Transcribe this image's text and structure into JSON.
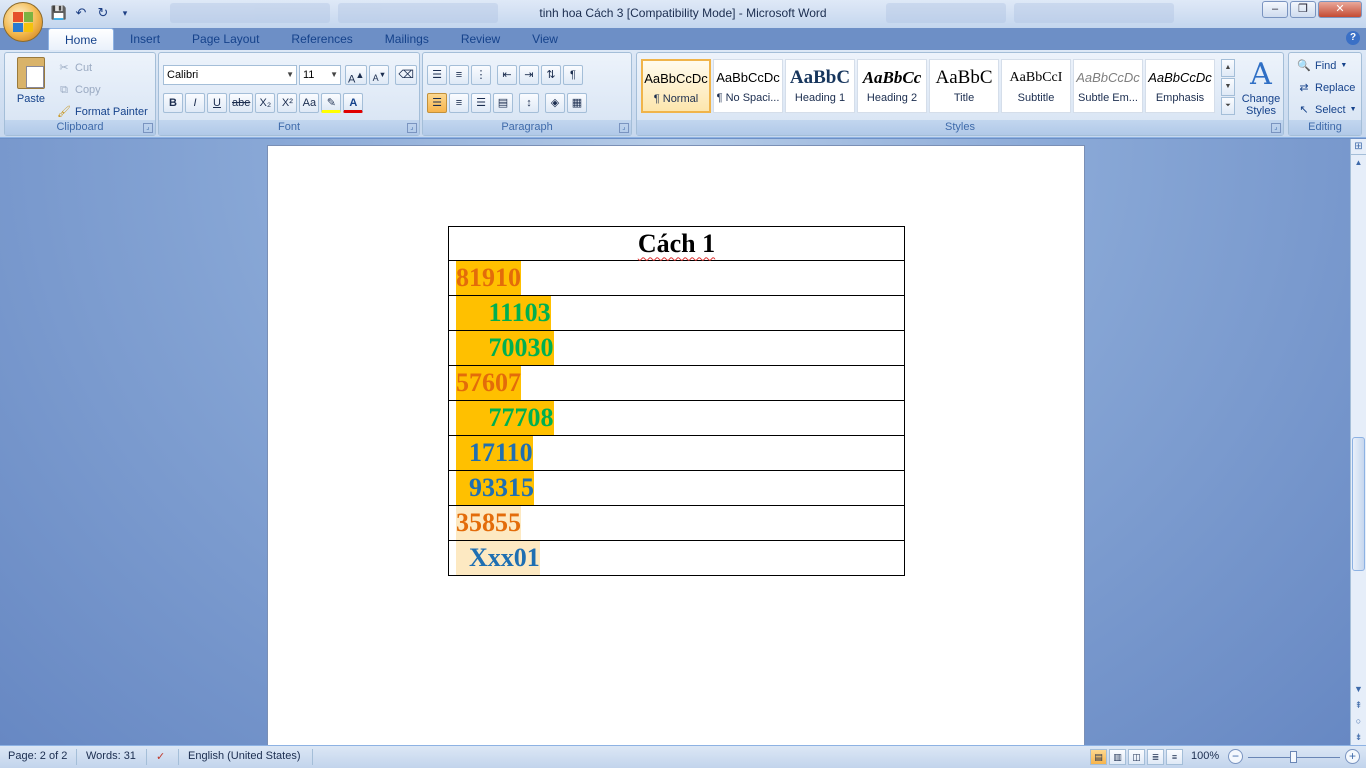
{
  "window": {
    "title": "tinh hoa Cách 3 [Compatibility Mode] - Microsoft Word",
    "controls": [
      "minimize",
      "maximize",
      "close"
    ]
  },
  "qat": [
    "save-icon",
    "undo-icon",
    "redo-icon",
    "customize-icon"
  ],
  "tabs": [
    {
      "label": "Home",
      "active": true
    },
    {
      "label": "Insert"
    },
    {
      "label": "Page Layout"
    },
    {
      "label": "References"
    },
    {
      "label": "Mailings"
    },
    {
      "label": "Review"
    },
    {
      "label": "View"
    }
  ],
  "ribbon": {
    "clipboard": {
      "label": "Clipboard",
      "paste": "Paste",
      "cut": "Cut",
      "copy": "Copy",
      "format_painter": "Format Painter"
    },
    "font": {
      "label": "Font",
      "name": "Calibri",
      "size": "11",
      "buttons": [
        "B",
        "I",
        "U",
        "abe",
        "X₂",
        "X²",
        "Aa"
      ]
    },
    "paragraph": {
      "label": "Paragraph"
    },
    "styles": {
      "label": "Styles",
      "items": [
        {
          "sample": "AaBbCcDc",
          "name": "¶ Normal",
          "selected": true
        },
        {
          "sample": "AaBbCcDc",
          "name": "¶ No Spaci..."
        },
        {
          "sample": "AaBbC",
          "name": "Heading 1"
        },
        {
          "sample": "AaBbCc",
          "name": "Heading 2"
        },
        {
          "sample": "AaBbC",
          "name": "Title"
        },
        {
          "sample": "AaBbCcI",
          "name": "Subtitle"
        },
        {
          "sample": "AaBbCcDc",
          "name": "Subtle Em..."
        },
        {
          "sample": "AaBbCcDc",
          "name": "Emphasis"
        }
      ],
      "change_styles_line1": "Change",
      "change_styles_line2": "Styles"
    },
    "editing": {
      "label": "Editing",
      "find": "Find",
      "replace": "Replace",
      "select": "Select"
    }
  },
  "document": {
    "table_header": "Cách 1",
    "rows": [
      {
        "text": "81910",
        "color": "#e36c0a",
        "highlight": "#ffc000"
      },
      {
        "text": "     11103",
        "color": "#00b050",
        "highlight": "#ffc000"
      },
      {
        "text": "     70030",
        "color": "#00b050",
        "highlight": "#ffc000"
      },
      {
        "text": "57607",
        "color": "#e36c0a",
        "highlight": "#ffc000"
      },
      {
        "text": "     77708",
        "color": "#00b050",
        "highlight": "#ffc000"
      },
      {
        "text": "  17110",
        "color": "#1f6fb2",
        "highlight": "#ffc000"
      },
      {
        "text": "  93315",
        "color": "#1f6fb2",
        "highlight": "#ffc000"
      },
      {
        "text": "35855",
        "color": "#e36c0a",
        "highlight": "#fde9c2"
      },
      {
        "text": "  Xxx01",
        "color": "#1f6fb2",
        "highlight": "#fde9c2"
      }
    ]
  },
  "status": {
    "page": "Page: 2 of 2",
    "words": "Words: 31",
    "language": "English (United States)",
    "zoom": "100%"
  },
  "colors": {
    "ribbon_bg": "#c7d8ee",
    "doc_bg": "#6788c3",
    "accent": "#15428b"
  }
}
